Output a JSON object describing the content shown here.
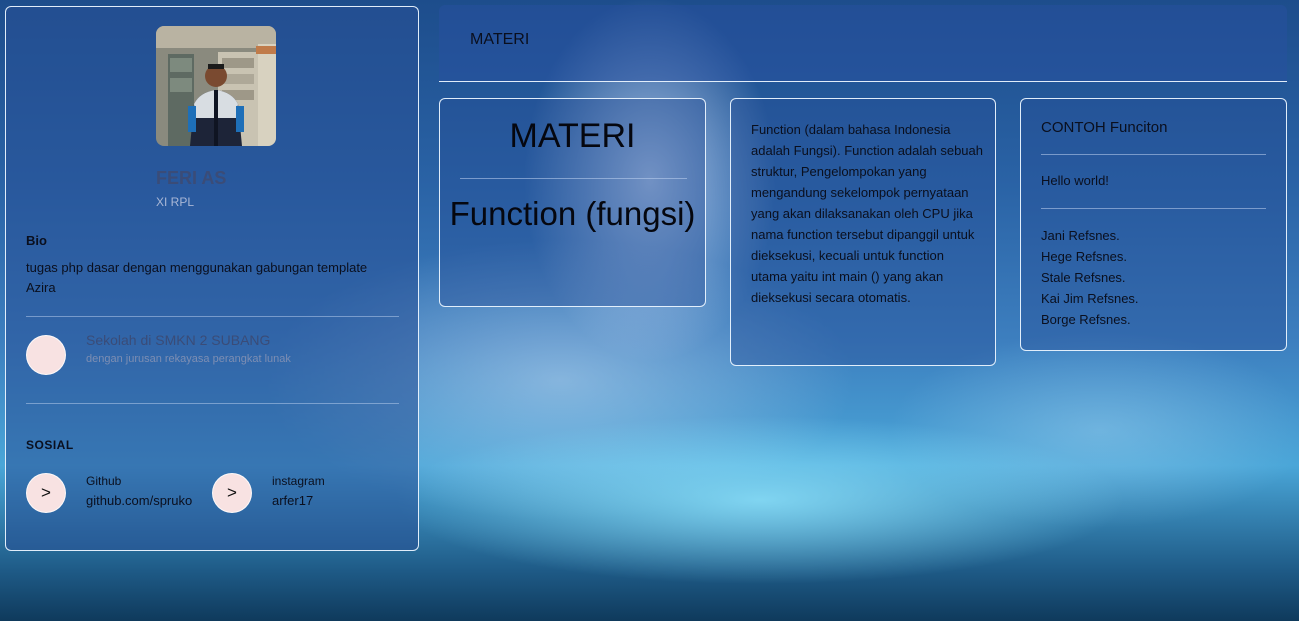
{
  "profile": {
    "name": "FERI AS",
    "class": "XI RPL",
    "bio_heading": "Bio",
    "bio_text": "tugas php dasar dengan menggunakan gabungan template Azira",
    "school": {
      "title": "Sekolah di SMKN 2 SUBANG",
      "subtitle": "dengan jurusan rekayasa perangkat lunak"
    },
    "social_heading": "SOSIAL",
    "social": [
      {
        "icon": ">",
        "label": "Github",
        "value": "github.com/spruko"
      },
      {
        "icon": ">",
        "label": "instagram",
        "value": "arfer17"
      }
    ]
  },
  "topbar": {
    "title": "MATERI"
  },
  "materi_card": {
    "heading": "MATERI",
    "subheading": "Function (fungsi)"
  },
  "description_card": {
    "text": "Function (dalam bahasa Indonesia adalah Fungsi). Function adalah sebuah struktur, Pengelompokan yang mengandung sekelompok pernyataan yang akan dilaksanakan oleh CPU jika nama function tersebut dipanggil untuk dieksekusi, kecuali untuk function utama yaitu int main () yang akan dieksekusi secara otomatis."
  },
  "example_card": {
    "title": "CONTOH Funciton",
    "hello": "Hello world!",
    "names": [
      "Jani Refsnes.",
      "Hege Refsnes.",
      "Stale Refsnes.",
      "Kai Jim Refsnes.",
      "Borge Refsnes."
    ]
  },
  "colors": {
    "card_border": "#ebf5ff",
    "circle_fill": "#f8e2e2",
    "name_text": "#3a4c78"
  }
}
